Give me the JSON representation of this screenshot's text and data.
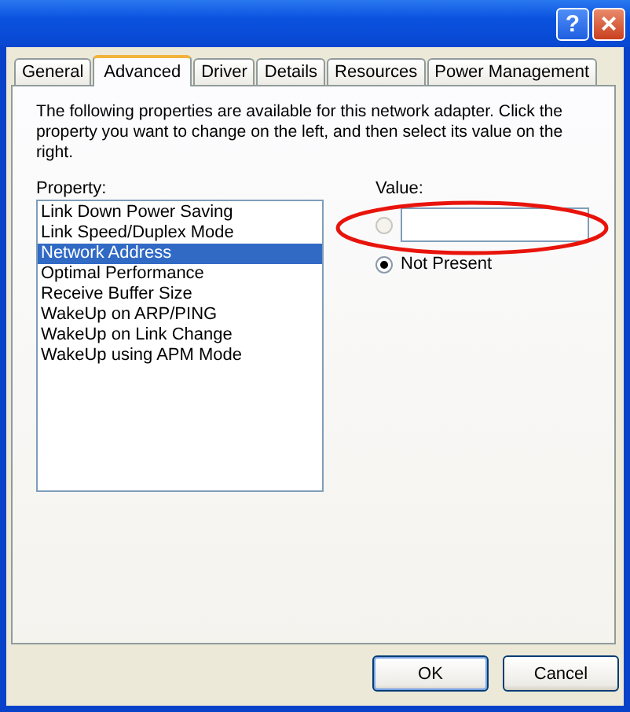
{
  "window": {
    "buttons": [
      "?",
      "×"
    ]
  },
  "tabs": [
    {
      "label": "General",
      "selected": false
    },
    {
      "label": "Advanced",
      "selected": true
    },
    {
      "label": "Driver",
      "selected": false
    },
    {
      "label": "Details",
      "selected": false
    },
    {
      "label": "Resources",
      "selected": false
    },
    {
      "label": "Power Management",
      "selected": false
    }
  ],
  "description": "The following properties are available for this network adapter. Click the property you want to change on the left, and then select its value on the right.",
  "property": {
    "label": "Property:",
    "items": [
      {
        "label": "Link Down Power Saving",
        "selected": false
      },
      {
        "label": "Link Speed/Duplex Mode",
        "selected": false
      },
      {
        "label": "Network Address",
        "selected": true
      },
      {
        "label": "Optimal Performance",
        "selected": false
      },
      {
        "label": "Receive Buffer Size",
        "selected": false
      },
      {
        "label": "WakeUp on ARP/PING",
        "selected": false
      },
      {
        "label": "WakeUp on Link Change",
        "selected": false
      },
      {
        "label": "WakeUp using APM Mode",
        "selected": false
      }
    ]
  },
  "value": {
    "label": "Value:",
    "options": [
      {
        "kind": "field",
        "selected": false
      },
      {
        "kind": "text",
        "label": "Not Present",
        "selected": true
      }
    ],
    "highlighted": true
  },
  "buttons": [
    "OK",
    "Cancel"
  ]
}
